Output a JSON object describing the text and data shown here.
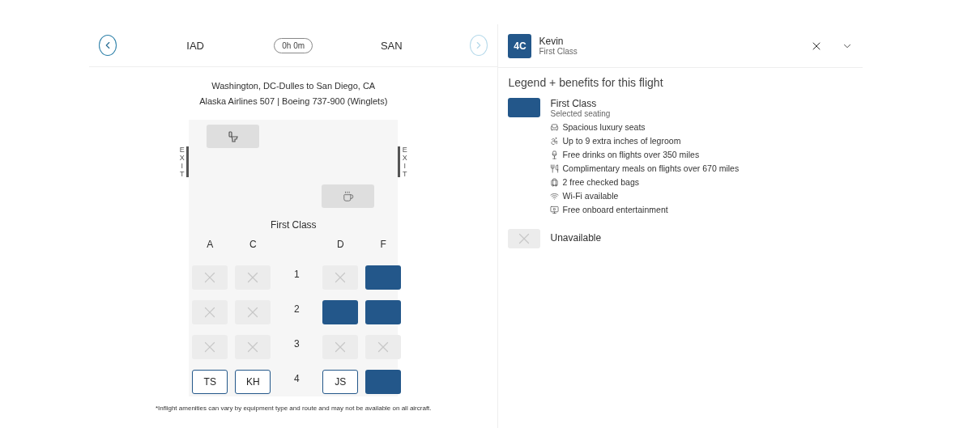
{
  "flight_bar": {
    "origin": "IAD",
    "duration": "0h 0m",
    "destination": "SAN",
    "prev_disabled": false,
    "next_disabled": true
  },
  "route": "Washington, DC-Dulles to San Diego, CA",
  "aircraft": "Alaska Airlines 507 | Boeing 737-900 (Winglets)",
  "exit_labels": [
    "EXIT",
    "EXIT"
  ],
  "cabin": {
    "title": "First Class",
    "columns": [
      "A",
      "C",
      "D",
      "F"
    ],
    "rows": [
      {
        "number": "1",
        "seats": [
          {
            "kind": "unavailable"
          },
          {
            "kind": "unavailable"
          },
          {
            "kind": "unavailable"
          },
          {
            "kind": "available"
          }
        ]
      },
      {
        "number": "2",
        "seats": [
          {
            "kind": "unavailable"
          },
          {
            "kind": "unavailable"
          },
          {
            "kind": "available"
          },
          {
            "kind": "available"
          }
        ]
      },
      {
        "number": "3",
        "seats": [
          {
            "kind": "unavailable"
          },
          {
            "kind": "unavailable"
          },
          {
            "kind": "unavailable"
          },
          {
            "kind": "unavailable"
          }
        ]
      },
      {
        "number": "4",
        "seats": [
          {
            "kind": "assigned",
            "label": "TS"
          },
          {
            "kind": "assigned",
            "label": "KH"
          },
          {
            "kind": "assigned",
            "label": "JS"
          },
          {
            "kind": "available"
          }
        ]
      }
    ]
  },
  "footnote": "*Inflight amenities can vary by equipment type and route and may not be available on all aircraft.",
  "passenger": {
    "seat": "4C",
    "name": "Kevin",
    "cabin": "First Class"
  },
  "legend": {
    "title": "Legend + benefits for this flight",
    "items": [
      {
        "kind": "available",
        "title": "First Class",
        "subtitle": "Selected seating",
        "benefits": [
          "Spacious luxury seats",
          "Up to 9 extra inches of legroom",
          "Free drinks on flights over 350 miles",
          "Complimentary meals on flights over 670 miles",
          "2 free checked bags",
          "Wi-Fi available",
          "Free onboard entertainment"
        ]
      },
      {
        "kind": "unavailable",
        "title": "Unavailable"
      }
    ]
  }
}
